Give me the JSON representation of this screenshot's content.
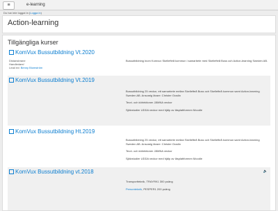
{
  "navbar": {
    "menu_icon": "hamburger-menu-icon",
    "menu_glyph": "≡",
    "brand": "e-learning"
  },
  "login_info": {
    "prefix": "Du har inte loggat in (",
    "link": "Logga in",
    "suffix": ")"
  },
  "site": {
    "title": "Action-learning"
  },
  "courses_section": {
    "heading": "Tillgängliga kurser",
    "courses": [
      {
        "title": "KomVux Bussutbildning Vt.2020",
        "meta_line1": "Distansbrane",
        "meta_line2": "Handledare/",
        "meta_label3": "Lead ed: ",
        "meta_link3": "Benny Blomström",
        "summary_p1": "Bussutbildning inom Komvux Skellefteå kommun i samarbete med Skellefteå Buss och Action-learning Sweden AB.",
        "summary_p2": "",
        "summary_p3": ""
      },
      {
        "title": "KomVux Bussutbildning Vt.2019",
        "summary_p1": "Bussutbildning 25 veckor, ett samarbete mellan Skellefteå Buss och Skellefteå kommun samt Action-learning Sweden AB. Ansvarig lärare: Christer Gradin",
        "summary_p2": "Teori- och körlektioner JÄMNA veckor",
        "summary_p3": "Självstudier UDDA veckor med hjälp av läsplattformen Moodle"
      },
      {
        "title": "KomVux Bussutbildning Ht.2019",
        "summary_p1": "Bussutbildning 25 veckor, ett samarbete mellan Skellefteå Buss och Skellefteå kommun samt Action-learning Sweden AB. Ansvarig lärare: Christer Gradin",
        "summary_p2": "Teori- och körlektioner JÄMNA veckor",
        "summary_p3": "Självstudier UDDA veckor med hjälp av läsplattformen Moodle"
      },
      {
        "title": "KomVux Bussutbildning vt.2018",
        "summary_p1": "Transportteknik, TRAYRK1 300 poäng",
        "summary_link2": "Personteknik",
        "summary_p2": ", PESPER1 200 poäng",
        "summary_p3": ""
      }
    ]
  },
  "colors": {
    "link": "#0a7dd0",
    "page_bg": "#ededed",
    "card_bg": "#ffffff"
  }
}
